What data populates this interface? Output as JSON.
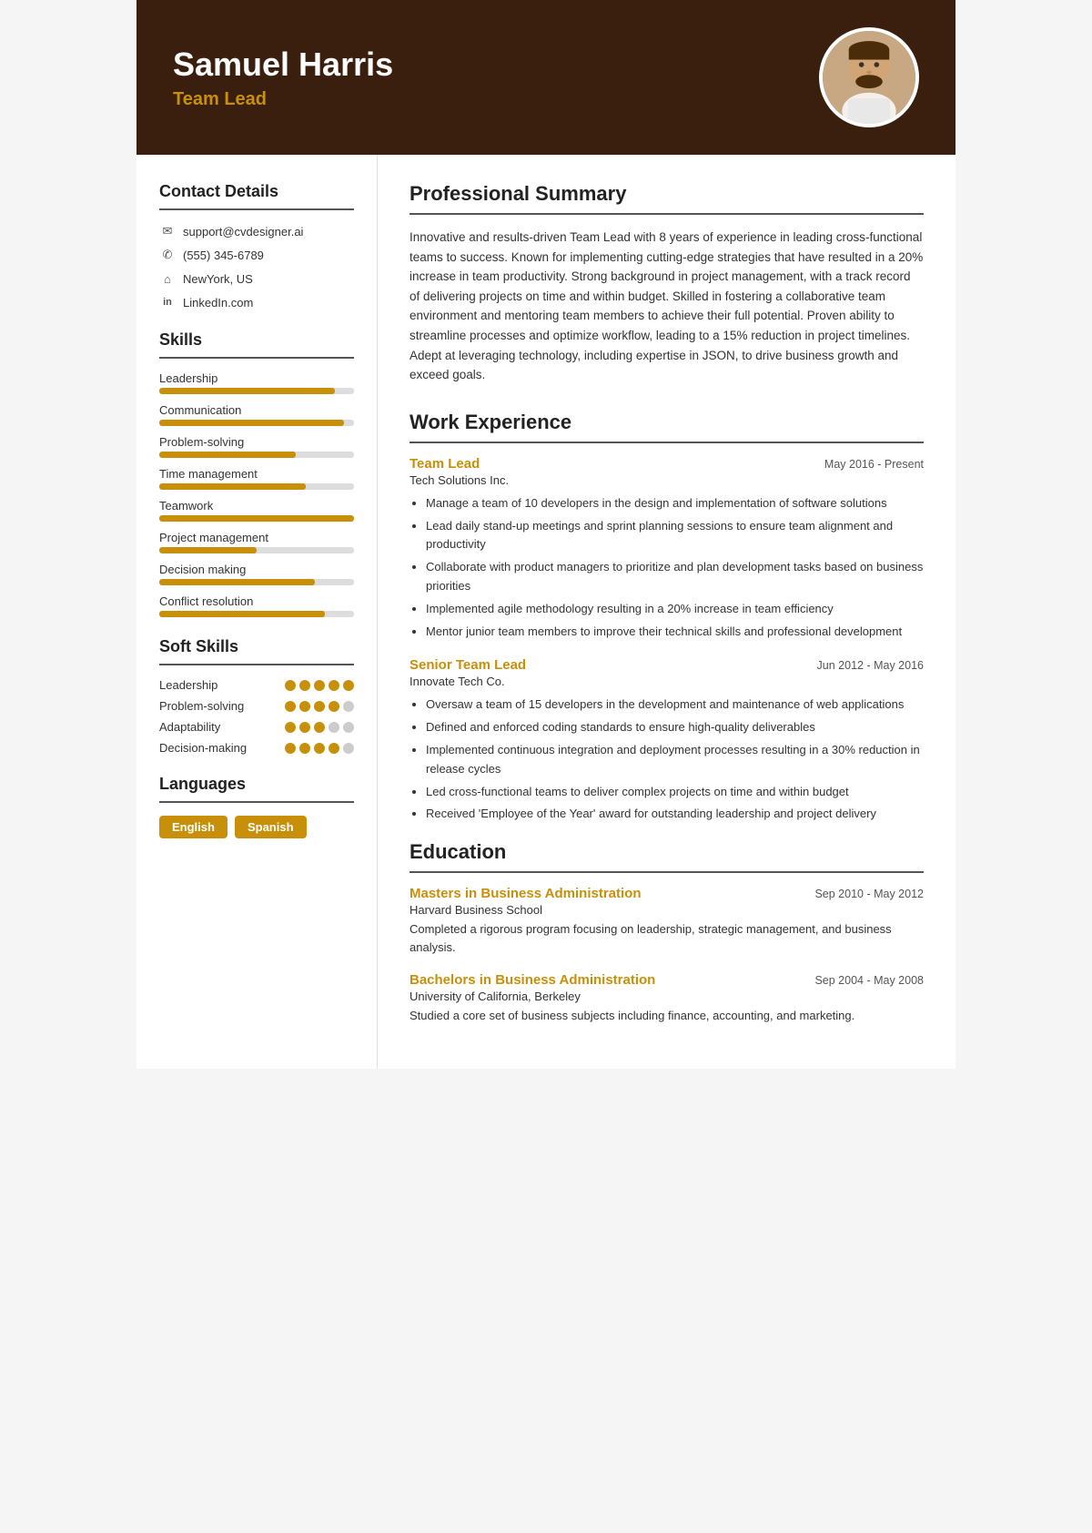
{
  "header": {
    "name": "Samuel Harris",
    "title": "Team Lead",
    "avatar_alt": "Profile photo"
  },
  "sidebar": {
    "contact_title": "Contact Details",
    "contact": {
      "email": "support@cvdesigner.ai",
      "phone": "(555) 345-6789",
      "location": "NewYork, US",
      "linkedin": "LinkedIn.com"
    },
    "skills_title": "Skills",
    "skills": [
      {
        "name": "Leadership",
        "percent": 90
      },
      {
        "name": "Communication",
        "percent": 95
      },
      {
        "name": "Problem-solving",
        "percent": 70
      },
      {
        "name": "Time management",
        "percent": 75
      },
      {
        "name": "Teamwork",
        "percent": 100
      },
      {
        "name": "Project management",
        "percent": 50
      },
      {
        "name": "Decision making",
        "percent": 80
      },
      {
        "name": "Conflict resolution",
        "percent": 85
      }
    ],
    "soft_skills_title": "Soft Skills",
    "soft_skills": [
      {
        "name": "Leadership",
        "filled": 5,
        "total": 5
      },
      {
        "name": "Problem-solving",
        "filled": 4,
        "total": 5
      },
      {
        "name": "Adaptability",
        "filled": 3,
        "total": 5
      },
      {
        "name": "Decision-making",
        "filled": 4,
        "total": 5
      }
    ],
    "languages_title": "Languages",
    "languages": [
      "English",
      "Spanish"
    ]
  },
  "main": {
    "summary_title": "Professional Summary",
    "summary": "Innovative and results-driven Team Lead with 8 years of experience in leading cross-functional teams to success. Known for implementing cutting-edge strategies that have resulted in a 20% increase in team productivity. Strong background in project management, with a track record of delivering projects on time and within budget. Skilled in fostering a collaborative team environment and mentoring team members to achieve their full potential. Proven ability to streamline processes and optimize workflow, leading to a 15% reduction in project timelines. Adept at leveraging technology, including expertise in JSON, to drive business growth and exceed goals.",
    "work_title": "Work Experience",
    "jobs": [
      {
        "title": "Team Lead",
        "date": "May 2016 - Present",
        "company": "Tech Solutions Inc.",
        "bullets": [
          "Manage a team of 10 developers in the design and implementation of software solutions",
          "Lead daily stand-up meetings and sprint planning sessions to ensure team alignment and productivity",
          "Collaborate with product managers to prioritize and plan development tasks based on business priorities",
          "Implemented agile methodology resulting in a 20% increase in team efficiency",
          "Mentor junior team members to improve their technical skills and professional development"
        ]
      },
      {
        "title": "Senior Team Lead",
        "date": "Jun 2012 - May 2016",
        "company": "Innovate Tech Co.",
        "bullets": [
          "Oversaw a team of 15 developers in the development and maintenance of web applications",
          "Defined and enforced coding standards to ensure high-quality deliverables",
          "Implemented continuous integration and deployment processes resulting in a 30% reduction in release cycles",
          "Led cross-functional teams to deliver complex projects on time and within budget",
          "Received 'Employee of the Year' award for outstanding leadership and project delivery"
        ]
      }
    ],
    "education_title": "Education",
    "education": [
      {
        "degree": "Masters in Business Administration",
        "date": "Sep 2010 - May 2012",
        "school": "Harvard Business School",
        "desc": "Completed a rigorous program focusing on leadership, strategic management, and business analysis."
      },
      {
        "degree": "Bachelors in Business Administration",
        "date": "Sep 2004 - May 2008",
        "school": "University of California, Berkeley",
        "desc": "Studied a core set of business subjects including finance, accounting, and marketing."
      }
    ]
  }
}
